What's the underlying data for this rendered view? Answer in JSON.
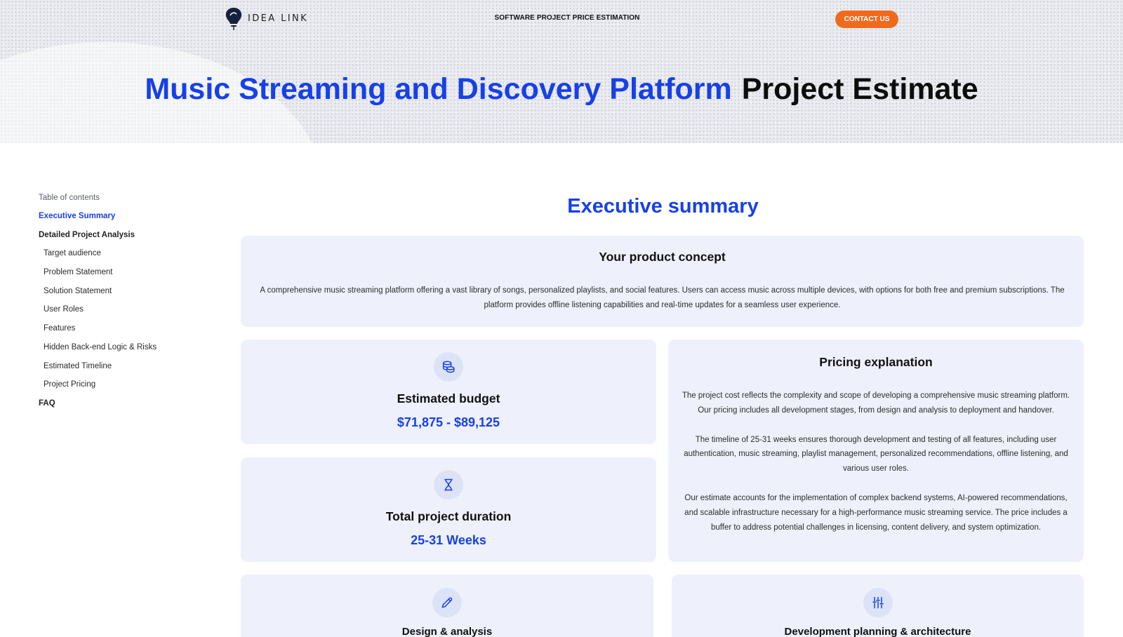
{
  "header": {
    "logo_text": "IDEA LINK",
    "nav_title": "SOFTWARE PROJECT PRICE ESTIMATION",
    "contact_label": "CONTACT US",
    "title_blue": "Music Streaming and Discovery Platform",
    "title_black": "Project Estimate"
  },
  "toc": {
    "heading": "Table of contents",
    "items": [
      {
        "label": "Executive Summary"
      },
      {
        "label": "Detailed Project Analysis"
      },
      {
        "label": "Target audience"
      },
      {
        "label": "Problem Statement"
      },
      {
        "label": "Solution Statement"
      },
      {
        "label": "User Roles"
      },
      {
        "label": "Features"
      },
      {
        "label": "Hidden Back-end Logic & Risks"
      },
      {
        "label": "Estimated Timeline"
      },
      {
        "label": "Project Pricing"
      },
      {
        "label": "FAQ"
      }
    ]
  },
  "main": {
    "section_title": "Executive summary",
    "concept": {
      "heading": "Your product concept",
      "text": "A comprehensive music streaming platform offering a vast library of songs, personalized playlists, and social features. Users can access music across multiple devices, with options for both free and premium subscriptions. The platform provides offline listening capabilities and real-time updates for a seamless user experience."
    },
    "budget": {
      "icon": "coins-icon",
      "heading": "Estimated budget",
      "value": "$71,875 - $89,125"
    },
    "duration": {
      "icon": "hourglass-icon",
      "heading": "Total project duration",
      "value": "25-31 Weeks"
    },
    "pricing": {
      "heading": "Pricing explanation",
      "paragraphs": [
        "The project cost reflects the complexity and scope of developing a comprehensive music streaming platform. Our pricing includes all development stages, from design and analysis to deployment and handover.",
        "The timeline of 25-31 weeks ensures thorough development and testing of all features, including user authentication, music streaming, playlist management, personalized recommendations, offline listening, and various user roles.",
        "Our estimate accounts for the implementation of complex backend systems, AI-powered recommendations, and scalable infrastructure necessary for a high-performance music streaming service. The price includes a buffer to address potential challenges in licensing, content delivery, and system optimization."
      ]
    },
    "phases": [
      {
        "icon": "pencil-icon",
        "title": "Design & analysis"
      },
      {
        "icon": "sliders-icon",
        "title": "Development planning & architecture"
      }
    ]
  },
  "colors": {
    "accent_blue": "#1740e8",
    "cta_orange": "#f06a1e",
    "card_bg": "#eef1fb"
  }
}
